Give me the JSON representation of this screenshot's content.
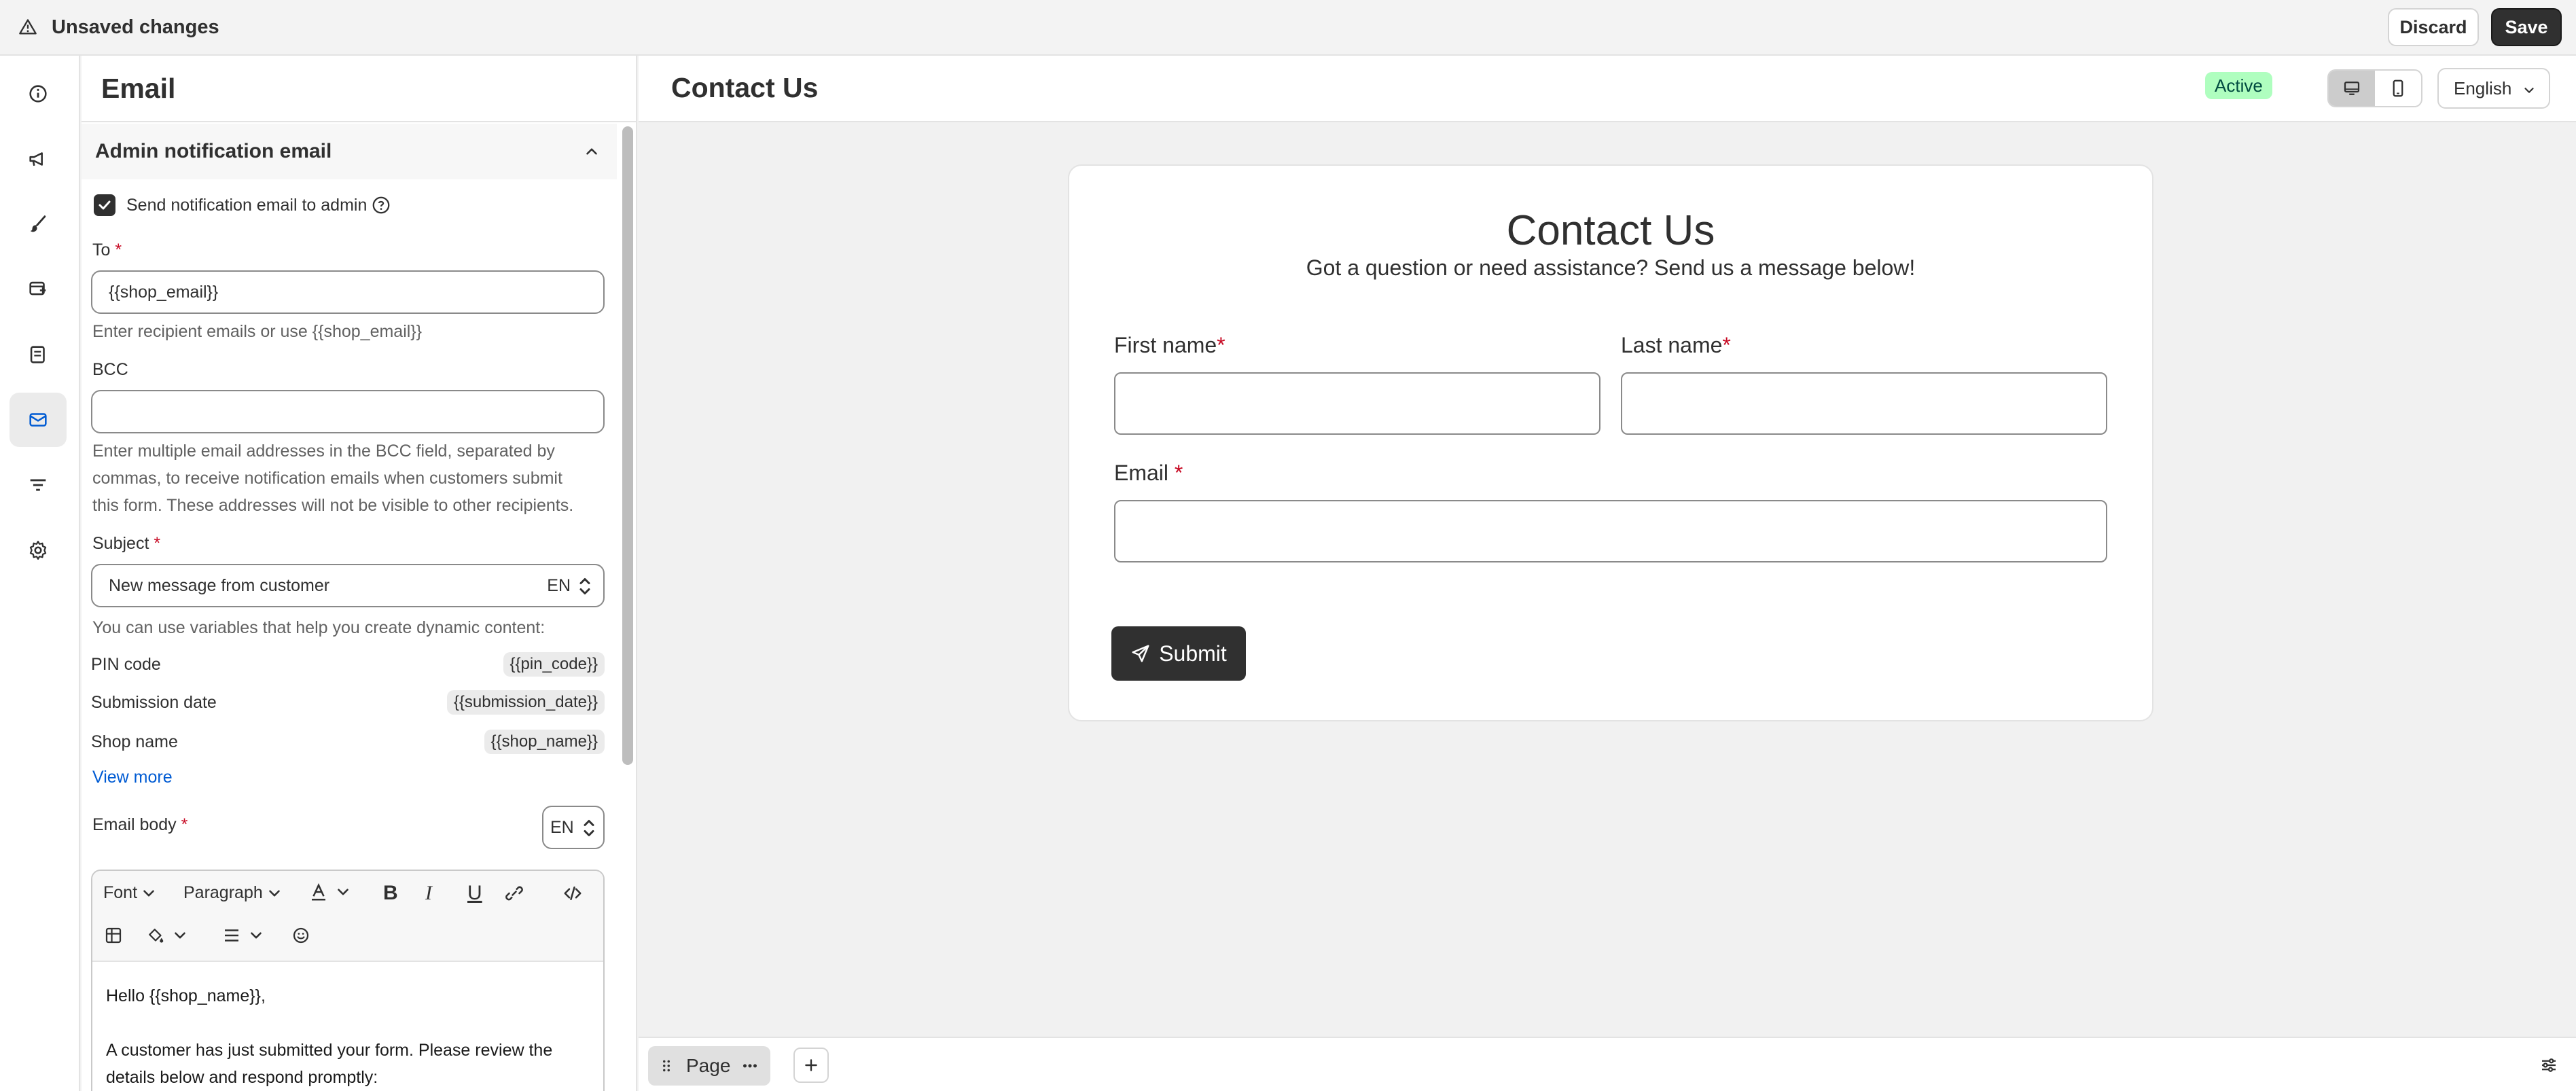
{
  "topbar": {
    "title": "Unsaved changes",
    "discard_label": "Discard",
    "save_label": "Save"
  },
  "rail": {
    "items": [
      {
        "icon": "info-icon"
      },
      {
        "icon": "megaphone-icon"
      },
      {
        "icon": "paintbrush-icon"
      },
      {
        "icon": "layout-icon"
      },
      {
        "icon": "form-icon"
      },
      {
        "icon": "email-icon",
        "active": true
      },
      {
        "icon": "filter-icon"
      },
      {
        "icon": "gear-icon"
      }
    ]
  },
  "panel": {
    "title": "Email",
    "section_title": "Admin notification email",
    "send_checkbox_label": "Send notification email to admin",
    "to_label": "To",
    "to_value": "{{shop_email}}",
    "to_help": "Enter recipient emails or use {{shop_email}}",
    "bcc_label": "BCC",
    "bcc_value": "",
    "bcc_help_1": "Enter multiple email addresses in the BCC field, separated by",
    "bcc_help_2": "commas, to receive notification emails when customers submit",
    "bcc_help_3": "this form. These addresses will not be visible to other recipients.",
    "subject_label": "Subject",
    "subject_value": "New message from customer",
    "subject_lang": "EN",
    "variables_help": "You can use variables that help you create dynamic content:",
    "variables": [
      {
        "label": "PIN code",
        "tag": "{{pin_code}}"
      },
      {
        "label": "Submission date",
        "tag": "{{submission_date}}"
      },
      {
        "label": "Shop name",
        "tag": "{{shop_name}}"
      }
    ],
    "view_more": "View more",
    "body_label": "Email body",
    "body_lang": "EN",
    "editor": {
      "font_label": "Font",
      "paragraph_label": "Paragraph",
      "line_1": "Hello {{shop_name}},",
      "line_2": "A customer has just submitted your form. Please review the",
      "line_3": "details below and respond promptly:"
    }
  },
  "preview": {
    "title": "Contact Us",
    "status": "Active",
    "language": "English",
    "form": {
      "heading": "Contact Us",
      "subheading": "Got a question or need assistance? Send us a message below!",
      "first_name": "First name",
      "last_name": "Last name",
      "email": "Email",
      "required_mark": "*",
      "submit": "Submit"
    },
    "bottom": {
      "page_tab": "Page"
    }
  }
}
